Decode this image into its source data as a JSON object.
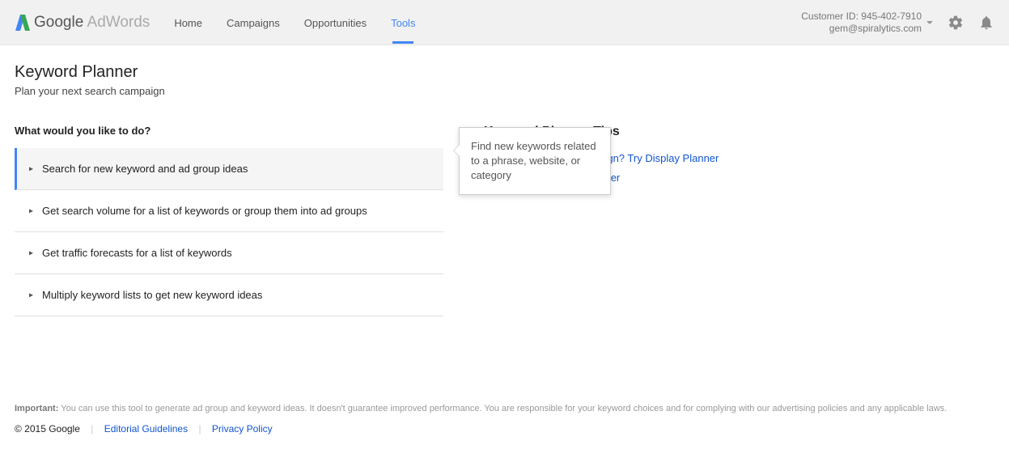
{
  "header": {
    "brand_g": "Google",
    "brand_aw": "AdWords",
    "nav": [
      "Home",
      "Campaigns",
      "Opportunities",
      "Tools"
    ],
    "active_nav_index": 3,
    "customer_id_label": "Customer ID: 945-402-7910",
    "email": "gem@spiralytics.com"
  },
  "page": {
    "title": "Keyword Planner",
    "subtitle": "Plan your next search campaign",
    "prompt": "What would you like to do?",
    "options": [
      "Search for new keyword and ad group ideas",
      "Get search volume for a list of keywords or group them into ad groups",
      "Get traffic forecasts for a list of keywords",
      "Multiply keyword lists to get new keyword ideas"
    ],
    "active_option_index": 0
  },
  "tooltip": {
    "text": "Find new keywords related to a phrase, website, or category"
  },
  "tips": {
    "title": "Keyword Planner Tips",
    "link1": "paign? Try Display Planner",
    "link2": "anner"
  },
  "footer": {
    "important_label": "Important:",
    "important_text": "You can use this tool to generate ad group and keyword ideas. It doesn't guarantee improved performance. You are responsible for your keyword choices and for complying with our advertising policies and any applicable laws.",
    "copyright": "© 2015 Google",
    "link_guidelines": "Editorial Guidelines",
    "link_privacy": "Privacy Policy"
  }
}
